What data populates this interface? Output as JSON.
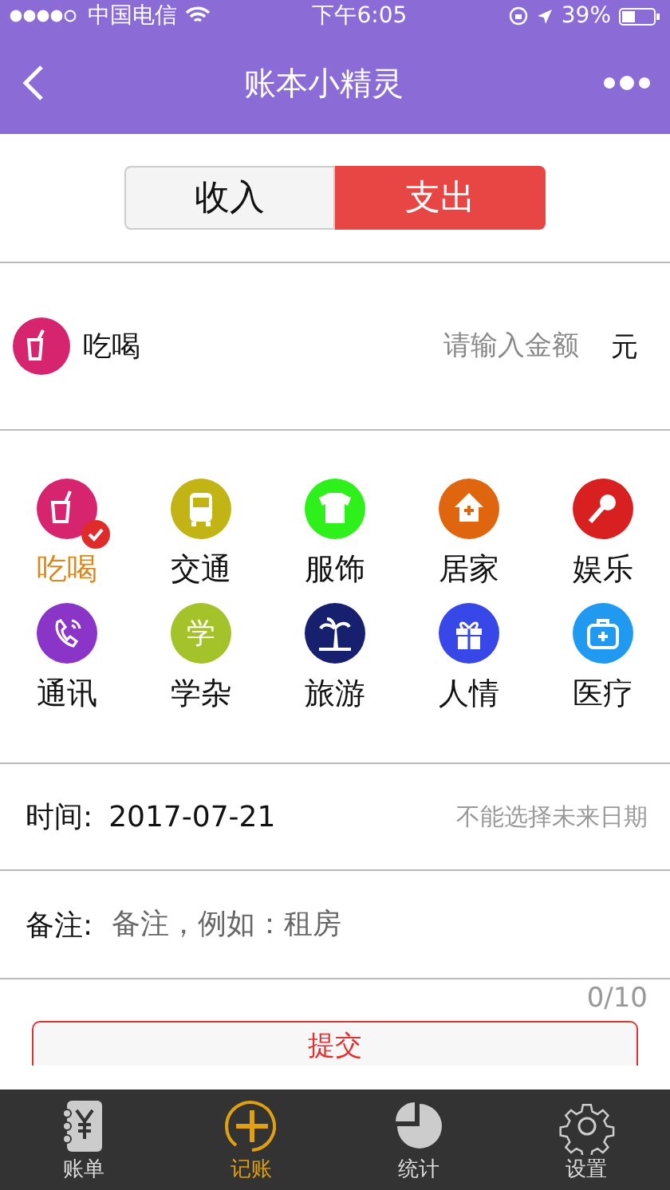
{
  "status_bar": {
    "carrier": "中国电信",
    "time": "下午6:05",
    "battery": "39%"
  },
  "nav": {
    "title": "账本小精灵"
  },
  "type_tabs": [
    {
      "label": "收入",
      "selected": false
    },
    {
      "label": "支出",
      "selected": true
    }
  ],
  "current_category": {
    "label": "吃喝",
    "amount_placeholder": "请输入金额",
    "unit": "元"
  },
  "categories": [
    {
      "label": "吃喝",
      "color": "#d6246e",
      "selected": true
    },
    {
      "label": "交通",
      "color": "#c2b414",
      "selected": false
    },
    {
      "label": "服饰",
      "color": "#2ef01a",
      "selected": false
    },
    {
      "label": "居家",
      "color": "#e0650f",
      "selected": false
    },
    {
      "label": "娱乐",
      "color": "#d82020",
      "selected": false
    },
    {
      "label": "通讯",
      "color": "#8a35c8",
      "selected": false
    },
    {
      "label": "学杂",
      "color": "#a4c22a",
      "selected": false,
      "glyph": "学"
    },
    {
      "label": "旅游",
      "color": "#16206e",
      "selected": false
    },
    {
      "label": "人情",
      "color": "#3848e8",
      "selected": false
    },
    {
      "label": "医疗",
      "color": "#1f9af0",
      "selected": false
    }
  ],
  "date": {
    "label": "时间:",
    "value": "2017-07-21",
    "hint": "不能选择未来日期"
  },
  "note": {
    "label": "备注:",
    "placeholder": "备注，例如：租房",
    "counter": "0/10"
  },
  "submit": "提交",
  "tab_bar": [
    {
      "label": "账单",
      "selected": false
    },
    {
      "label": "记账",
      "selected": true
    },
    {
      "label": "统计",
      "selected": false
    },
    {
      "label": "设置",
      "selected": false
    }
  ]
}
